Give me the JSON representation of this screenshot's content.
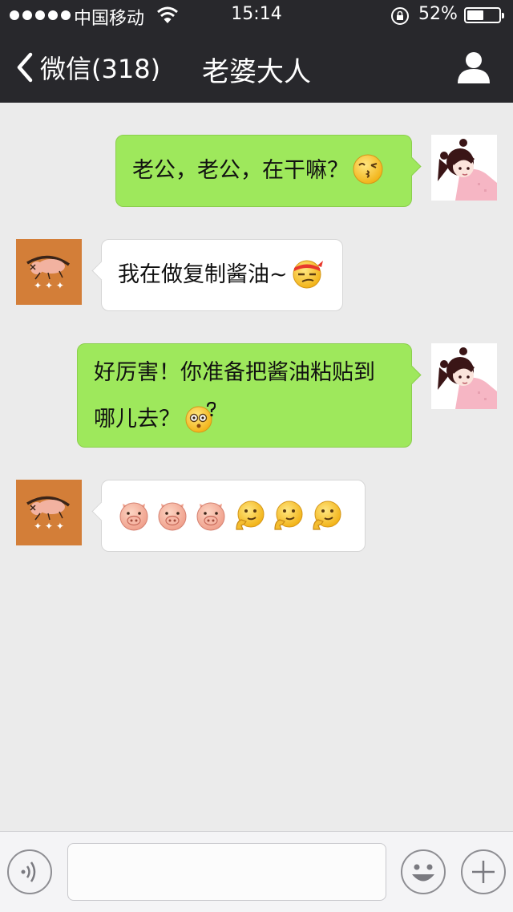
{
  "status_bar": {
    "carrier": "中国移动",
    "time": "15:14",
    "battery_percent": "52%",
    "battery_level": 0.52,
    "signal_dots": 5
  },
  "nav": {
    "back_label": "微信(318)",
    "title": "老婆大人"
  },
  "messages": [
    {
      "from": "me",
      "text": "老公，老公，在干嘛？",
      "emoji": [
        "kiss-face"
      ]
    },
    {
      "from": "other",
      "text": "我在做复制酱油~",
      "emoji": [
        "headband-smirk-face"
      ]
    },
    {
      "from": "me",
      "text_line1": "好厉害！你准备把酱油粘贴到",
      "text_line2": "哪儿去？",
      "emoji": [
        "confused-question-face"
      ]
    },
    {
      "from": "other",
      "text": "",
      "emoji": [
        "pig-face",
        "pig-face",
        "pig-face",
        "thinking-face",
        "thinking-face",
        "thinking-face"
      ]
    }
  ],
  "colors": {
    "header_bg": "#28282c",
    "chat_bg": "#ebebeb",
    "my_bubble": "#9ee85c",
    "their_bubble": "#ffffff",
    "their_avatar_bg": "#d37e38"
  },
  "input_bar": {
    "voice_icon": "voice-icon",
    "emoji_icon": "emoji-face-icon",
    "more_icon": "plus-icon",
    "text_value": ""
  }
}
